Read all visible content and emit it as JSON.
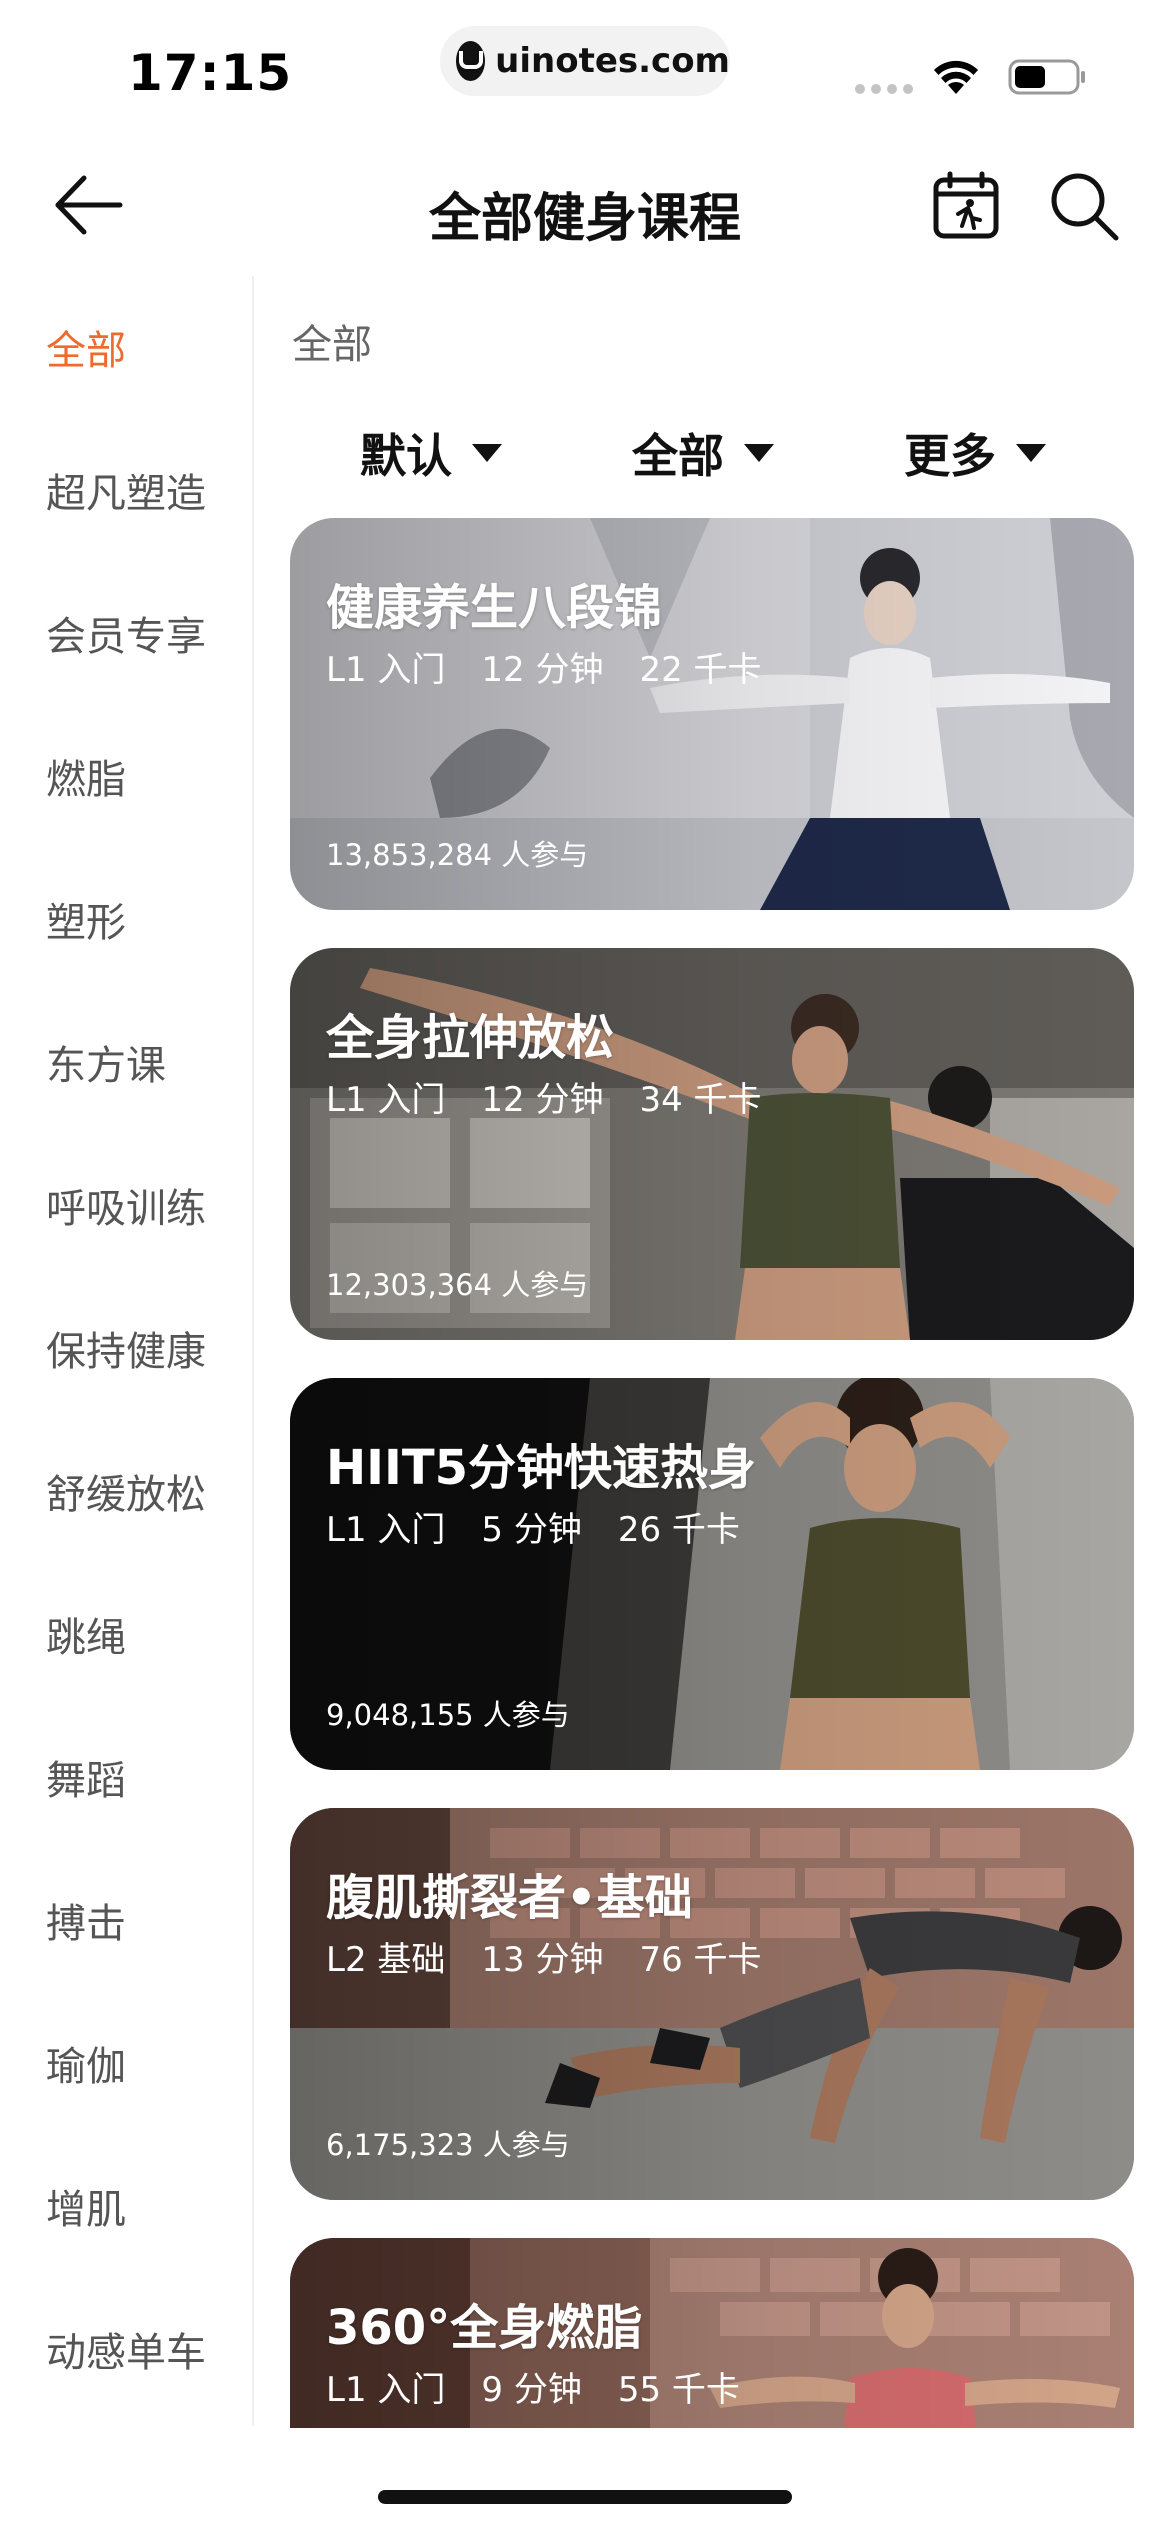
{
  "status_bar": {
    "time": "17:15",
    "url": "uinotes.com"
  },
  "nav": {
    "title": "全部健身课程"
  },
  "sidebar": {
    "items": [
      {
        "label": "全部",
        "active": true
      },
      {
        "label": "超凡塑造"
      },
      {
        "label": "会员专享"
      },
      {
        "label": "燃脂"
      },
      {
        "label": "塑形"
      },
      {
        "label": "东方课"
      },
      {
        "label": "呼吸训练"
      },
      {
        "label": "保持健康"
      },
      {
        "label": "舒缓放松"
      },
      {
        "label": "跳绳"
      },
      {
        "label": "舞蹈"
      },
      {
        "label": "搏击"
      },
      {
        "label": "瑜伽"
      },
      {
        "label": "增肌"
      },
      {
        "label": "动感单车"
      }
    ]
  },
  "main": {
    "section_title": "全部",
    "filters": [
      {
        "label": "默认"
      },
      {
        "label": "全部"
      },
      {
        "label": "更多"
      }
    ],
    "courses": [
      {
        "title": "健康养生八段锦",
        "level": "L1 入门",
        "duration": "12 分钟",
        "calories": "22 千卡",
        "participants": "13,853,284 人参与"
      },
      {
        "title": "全身拉伸放松",
        "level": "L1 入门",
        "duration": "12 分钟",
        "calories": "34 千卡",
        "participants": "12,303,364 人参与"
      },
      {
        "title": "HIIT5分钟快速热身",
        "level": "L1 入门",
        "duration": "5 分钟",
        "calories": "26 千卡",
        "participants": "9,048,155 人参与"
      },
      {
        "title": "腹肌撕裂者•基础",
        "level": "L2 基础",
        "duration": "13 分钟",
        "calories": "76 千卡",
        "participants": "6,175,323 人参与"
      },
      {
        "title": "360°全身燃脂",
        "level": "L1 入门",
        "duration": "9 分钟",
        "calories": "55 千卡",
        "participants": ""
      }
    ]
  },
  "colors": {
    "accent": "#ee6a2d",
    "sidebar_text": "#555555",
    "title_text": "#111111"
  },
  "icons": [
    "back-arrow-icon",
    "calendar-run-icon",
    "search-icon",
    "caret-down-icon",
    "wifi-icon",
    "battery-icon"
  ]
}
